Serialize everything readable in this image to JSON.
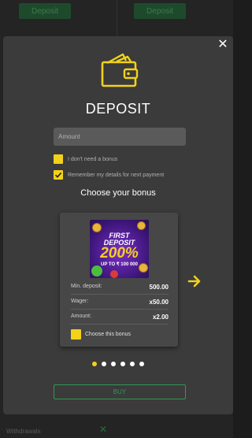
{
  "background": {
    "left_button_label": "Deposit",
    "right_button_label": "Deposit",
    "footer_text": "Withdrawals"
  },
  "modal": {
    "title": "DEPOSIT",
    "close_icon": "close-icon",
    "amount_placeholder": "Amount",
    "checkbox_no_bonus_label": "I don't need a bonus",
    "checkbox_remember_label": "Remember my details for next payment",
    "choose_title": "Choose your bonus",
    "buy_label": "BUY"
  },
  "bonus_card": {
    "promo": {
      "line1": "FIRST",
      "line2": "DEPOSIT",
      "percent": "200%",
      "upto": "UP TO ₹ 100 000"
    },
    "rows": [
      {
        "label": "Min. deposit:",
        "value": "500.00"
      },
      {
        "label": "Wager:",
        "value": "x50.00"
      },
      {
        "label": "Amount:",
        "value": "x2.00"
      }
    ],
    "choose_label": "Choose this bonus"
  },
  "pager": {
    "count": 6,
    "active_index": 0
  },
  "colors": {
    "accent_yellow": "#f2d21b",
    "buy_green": "#2e9a53",
    "modal_bg": "#3b3b3b"
  }
}
